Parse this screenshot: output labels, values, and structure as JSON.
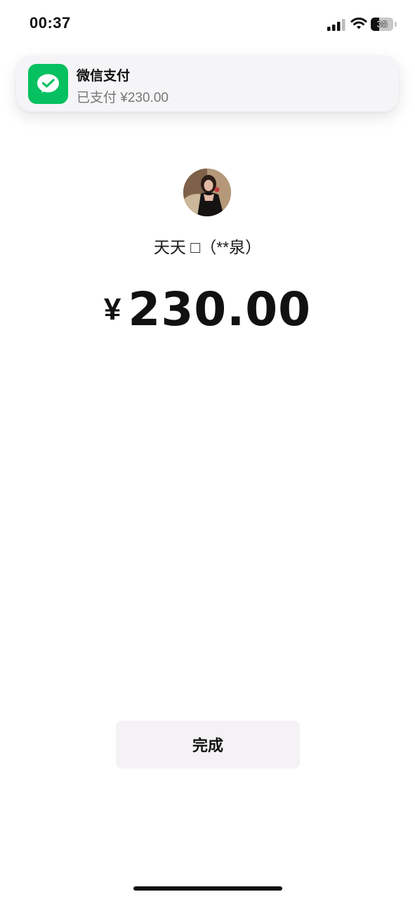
{
  "status_bar": {
    "time": "00:37",
    "battery_level": "38",
    "icons": [
      "cellular-signal-icon",
      "wifi-icon",
      "battery-icon"
    ]
  },
  "notification": {
    "app_icon": "wechat-pay-icon",
    "app_name": "微信支付",
    "message": "已支付 ¥230.00"
  },
  "payee": {
    "avatar": "payee-avatar",
    "name": "天天 □（**泉）"
  },
  "amount": {
    "currency_symbol": "¥",
    "value": "230.00"
  },
  "actions": {
    "done_label": "完成"
  },
  "colors": {
    "wechat_green": "#07c160",
    "button_bg": "#f4f2f5",
    "text_primary": "#111111",
    "text_secondary": "#777777"
  }
}
